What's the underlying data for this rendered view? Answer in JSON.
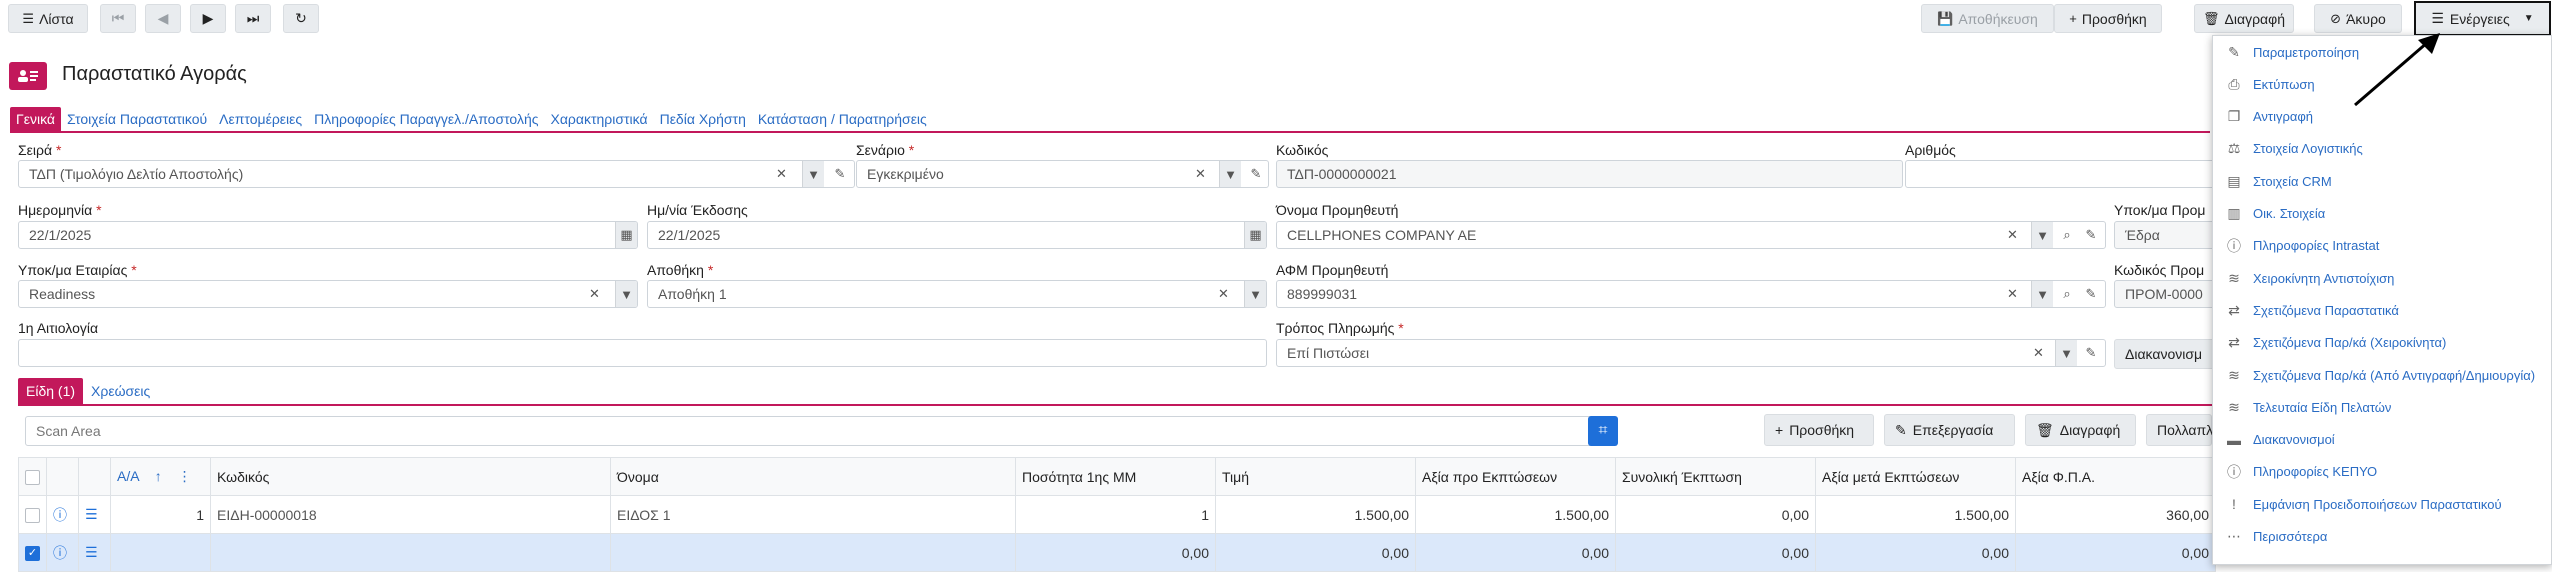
{
  "toolbar": {
    "list": "Λίστα",
    "save": "Αποθήκευση",
    "add": "Προσθήκη",
    "delete": "Διαγραφή",
    "cancel": "Άκυρο",
    "actions": "Ενέργειες"
  },
  "page": {
    "title": "Παραστατικό Αγοράς"
  },
  "tabs": [
    "Γενικά",
    "Στοιχεία Παραστατικού",
    "Λεπτομέρειες",
    "Πληροφορίες Παραγγελ./Αποστολής",
    "Χαρακτηριστικά",
    "Πεδία Χρήστη",
    "Κατάσταση / Παρατηρήσεις"
  ],
  "fields": {
    "series": {
      "label": "Σειρά",
      "value": "ΤΔΠ (Τιμολόγιο Δελτίο Αποστολής)"
    },
    "scenario": {
      "label": "Σενάριο",
      "value": "Εγκεκριμένο"
    },
    "code": {
      "label": "Κωδικός",
      "value": "ΤΔΠ-0000000021"
    },
    "number": {
      "label": "Αριθμός",
      "value": ""
    },
    "date": {
      "label": "Ημερομηνία",
      "value": "22/1/2025"
    },
    "issue_date": {
      "label": "Ημ/νία Έκδοσης",
      "value": "22/1/2025"
    },
    "supplier_name": {
      "label": "Όνομα Προμηθευτή",
      "value": "CELLPHONES COMPANY AE"
    },
    "supplier_branch": {
      "label": "Υποκ/μα Προμ",
      "value": "Έδρα"
    },
    "company_branch": {
      "label": "Υποκ/μα Εταιρίας",
      "value": "Readiness"
    },
    "warehouse": {
      "label": "Αποθήκη",
      "value": "Αποθήκη 1"
    },
    "supplier_vat": {
      "label": "ΑΦΜ Προμηθευτή",
      "value": "889999031"
    },
    "supplier_code": {
      "label": "Κωδικός Προμ",
      "value": "ΠΡΟΜ-0000"
    },
    "reason": {
      "label": "1η Αιτιολογία",
      "value": ""
    },
    "payment": {
      "label": "Τρόπος Πληρωμής",
      "value": "Επί Πιστώσει"
    },
    "settlements": "Διακανονισμ"
  },
  "subtabs": [
    "Είδη (1)",
    "Χρεώσεις"
  ],
  "grid": {
    "scan_placeholder": "Scan Area",
    "buttons": {
      "add": "Προσθήκη",
      "edit": "Επεξεργασία",
      "delete": "Διαγραφή",
      "multi": "Πολλαπλ"
    },
    "headers": [
      "Α/Α",
      "Κωδικός",
      "Όνομα",
      "Ποσότητα 1ης ΜΜ",
      "Τιμή",
      "Αξία προ Εκπτώσεων",
      "Συνολική Έκπτωση",
      "Αξία μετά Εκπτώσεων",
      "Αξία Φ.Π.Α."
    ],
    "rows": [
      {
        "aa": "1",
        "code": "ΕΙΔΗ-00000018",
        "name": "ΕΙΔΟΣ 1",
        "qty": "1",
        "price": "1.500,00",
        "gross": "1.500,00",
        "discount": "0,00",
        "net": "1.500,00",
        "vat": "360,00"
      }
    ],
    "totals": {
      "qty": "0,00",
      "price": "0,00",
      "gross": "0,00",
      "discount": "0,00",
      "net": "0,00",
      "vat": "0,00"
    }
  },
  "menu": [
    {
      "icon": "edit-icon",
      "glyph": "✎",
      "label": "Παραμετροποίηση"
    },
    {
      "icon": "print-icon",
      "glyph": "⎙",
      "label": "Εκτύπωση"
    },
    {
      "icon": "copy-icon",
      "glyph": "❐",
      "label": "Αντιγραφή"
    },
    {
      "icon": "balance-icon",
      "glyph": "⚖",
      "label": "Στοιχεία Λογιστικής"
    },
    {
      "icon": "crm-icon",
      "glyph": "▤",
      "label": "Στοιχεία CRM"
    },
    {
      "icon": "chart-icon",
      "glyph": "▥",
      "label": "Οικ. Στοιχεία"
    },
    {
      "icon": "info-icon",
      "glyph": "ⓘ",
      "label": "Πληροφορίες Intrastat"
    },
    {
      "icon": "layers-icon",
      "glyph": "≋",
      "label": "Χειροκίνητη Αντιστοίχιση"
    },
    {
      "icon": "transfer-icon",
      "glyph": "⇄",
      "label": "Σχετιζόμενα Παραστατικά"
    },
    {
      "icon": "transfer-icon",
      "glyph": "⇄",
      "label": "Σχετιζόμενα Παρ/κά (Χειροκίνητα)"
    },
    {
      "icon": "layers-icon",
      "glyph": "≋",
      "label": "Σχετιζόμενα Παρ/κά (Από Αντιγραφή/Δημιουργία)"
    },
    {
      "icon": "layers-icon",
      "glyph": "≋",
      "label": "Τελευταία Είδη Πελατών"
    },
    {
      "icon": "money-icon",
      "glyph": "▬",
      "label": "Διακανονισμοί"
    },
    {
      "icon": "info-icon",
      "glyph": "ⓘ",
      "label": "Πληροφορίες ΚΕΠΥΟ"
    },
    {
      "icon": "alert-icon",
      "glyph": "!",
      "label": "Εμφάνιση Προειδοποιήσεων Παραστατικού"
    },
    {
      "icon": "more-icon",
      "glyph": "⋯",
      "label": "Περισσότερα"
    }
  ]
}
